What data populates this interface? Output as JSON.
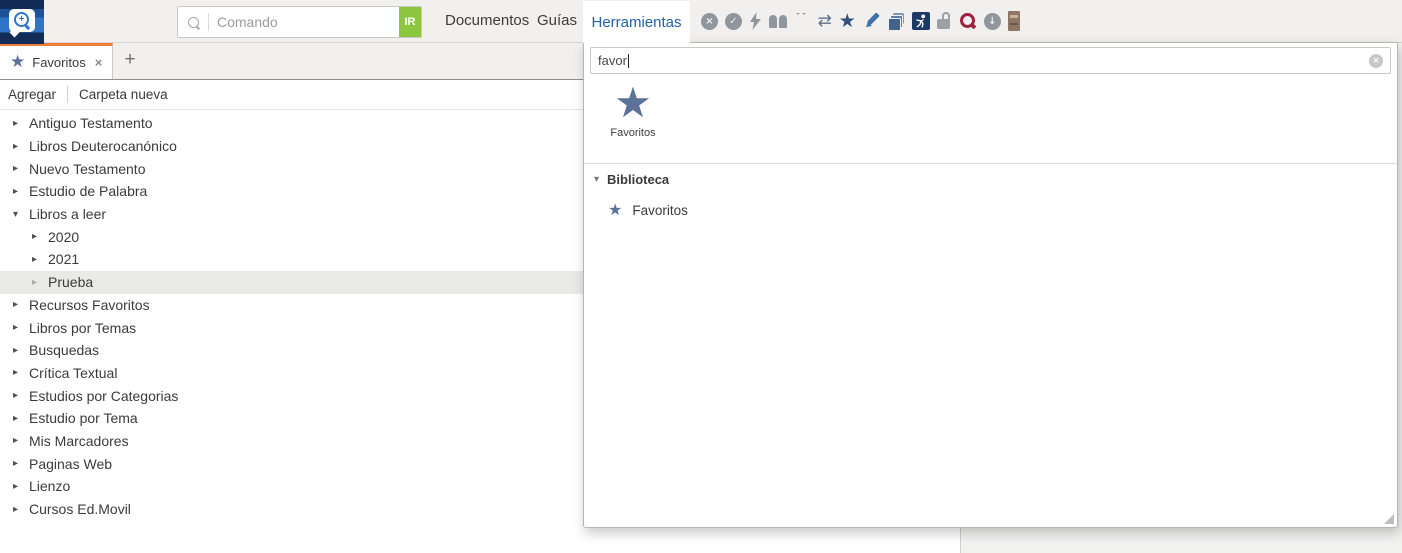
{
  "topbar": {
    "command_search": {
      "placeholder": "Comando",
      "go_label": "IR"
    },
    "menu_items": [
      {
        "label": "Documentos"
      },
      {
        "label": "Guías"
      }
    ],
    "nav_icons": [
      "app-logo",
      "home",
      "library",
      "notes-book",
      "command-search"
    ],
    "quick_tool_icons": [
      "circle-x",
      "circle-check",
      "lightning",
      "open-book",
      "quotation",
      "swap-arrows",
      "star",
      "pencil",
      "copy-stack",
      "figure-tile",
      "open-lock",
      "magnifier",
      "circle-down-arrow",
      "book-spine"
    ]
  },
  "tools_menu": {
    "tab_label": "Herramientas",
    "search": {
      "value": "favor"
    },
    "top_result": {
      "label": "Favoritos"
    },
    "library": {
      "header": "Biblioteca",
      "items": [
        {
          "label": "Favoritos"
        }
      ]
    }
  },
  "favorites": {
    "tab_label": "Favoritos",
    "close_tab_glyph": "×",
    "new_tab_glyph": "+",
    "toolbar": {
      "add_label": "Agregar",
      "new_folder_label": "Carpeta nueva"
    },
    "tree": [
      {
        "label": "Antiguo Testamento"
      },
      {
        "label": "Libros Deuterocanónico"
      },
      {
        "label": "Nuevo Testamento"
      },
      {
        "label": "Estudio de Palabra"
      },
      {
        "label": "Libros a leer",
        "expanded": true
      },
      {
        "label": "2020",
        "child": true
      },
      {
        "label": "2021",
        "child": true
      },
      {
        "label": "Prueba",
        "child": true,
        "selected": true
      },
      {
        "label": "Recursos Favoritos"
      },
      {
        "label": "Libros por Temas"
      },
      {
        "label": "Busquedas"
      },
      {
        "label": "Crítica Textual"
      },
      {
        "label": "Estudios por Categorias"
      },
      {
        "label": "Estudio por Tema"
      },
      {
        "label": "Mis Marcadores"
      },
      {
        "label": "Paginas Web"
      },
      {
        "label": "Lienzo"
      },
      {
        "label": "Cursos Ed.Movil"
      }
    ]
  },
  "colors": {
    "accent_orange": "#ee7e35",
    "active_blue": "#2460a7",
    "star_blue": "#5c7299",
    "go_green": "#8dc63f",
    "magnifier_red": "#9e2241",
    "logo_navy": "#132b57",
    "toolbar_gray": "#f1f0ee"
  }
}
